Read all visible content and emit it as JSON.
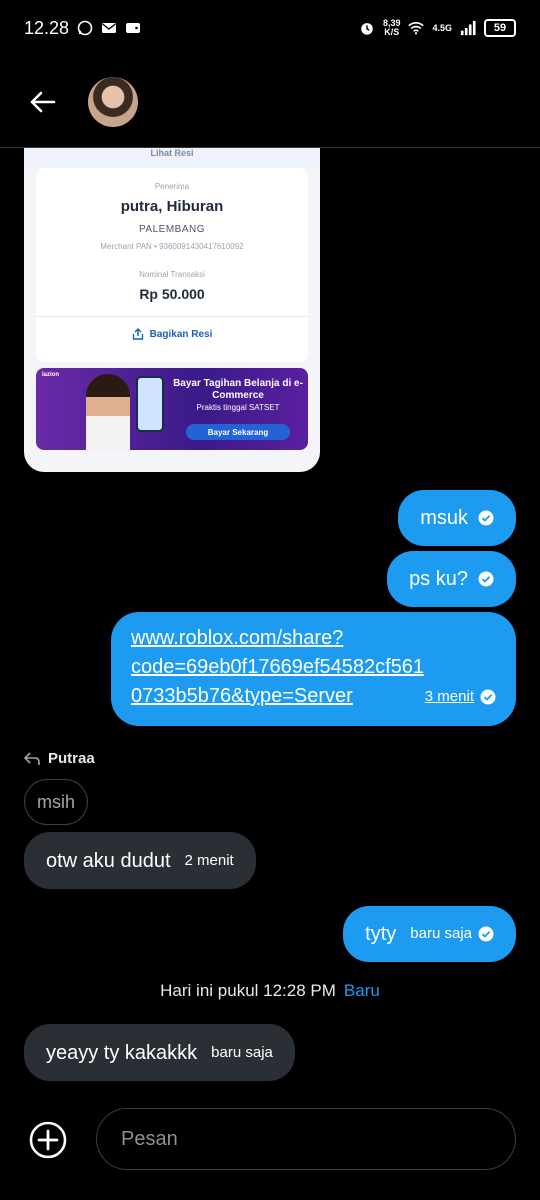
{
  "status_bar": {
    "time": "12.28",
    "net_speed_value": "8,39",
    "net_speed_unit": "K/S",
    "network": "4.5G",
    "battery": "59"
  },
  "header": {
    "back_icon": "arrow-left-icon",
    "avatar_icon": "profile-avatar"
  },
  "receipt": {
    "header_text": "Lihat Resi",
    "recipient_label": "Penerima",
    "recipient_name": "putra, Hiburan",
    "city": "PALEMBANG",
    "merchant_pan": "Merchant PAN • 9360091430417610092",
    "amount_label": "Nominal Transaksi",
    "amount": "Rp 50.000",
    "share_label": "Bagikan Resi",
    "banner_logo": "lazion",
    "banner_title": "Bayar Tagihan Belanja di e-Commerce",
    "banner_sub": "Praktis tinggal SATSET",
    "banner_button": "Bayar Sekarang"
  },
  "messages": {
    "m1": {
      "text": "msuk"
    },
    "m2": {
      "text": "ps ku?"
    },
    "m3": {
      "line1": "www.roblox.com/share?",
      "line2": "code=69eb0f17669ef54582cf561",
      "line3": "0733b5b76&type=Server",
      "time": "3 menit"
    },
    "reply_to": "Putraa",
    "quoted": "msih",
    "m4": {
      "text": "otw aku dudut",
      "time": "2 menit"
    },
    "m5": {
      "text": "tyty",
      "time": "baru saja"
    },
    "m6": {
      "text": "yeayy ty kakakkk",
      "time": "baru saja"
    }
  },
  "divider": {
    "text": "Hari ini pukul 12:28 PM",
    "new_label": "Baru"
  },
  "composer": {
    "placeholder": "Pesan"
  },
  "colors": {
    "accent": "#1d9bf0",
    "incoming_bubble": "#2a2f35",
    "background": "#000000"
  }
}
